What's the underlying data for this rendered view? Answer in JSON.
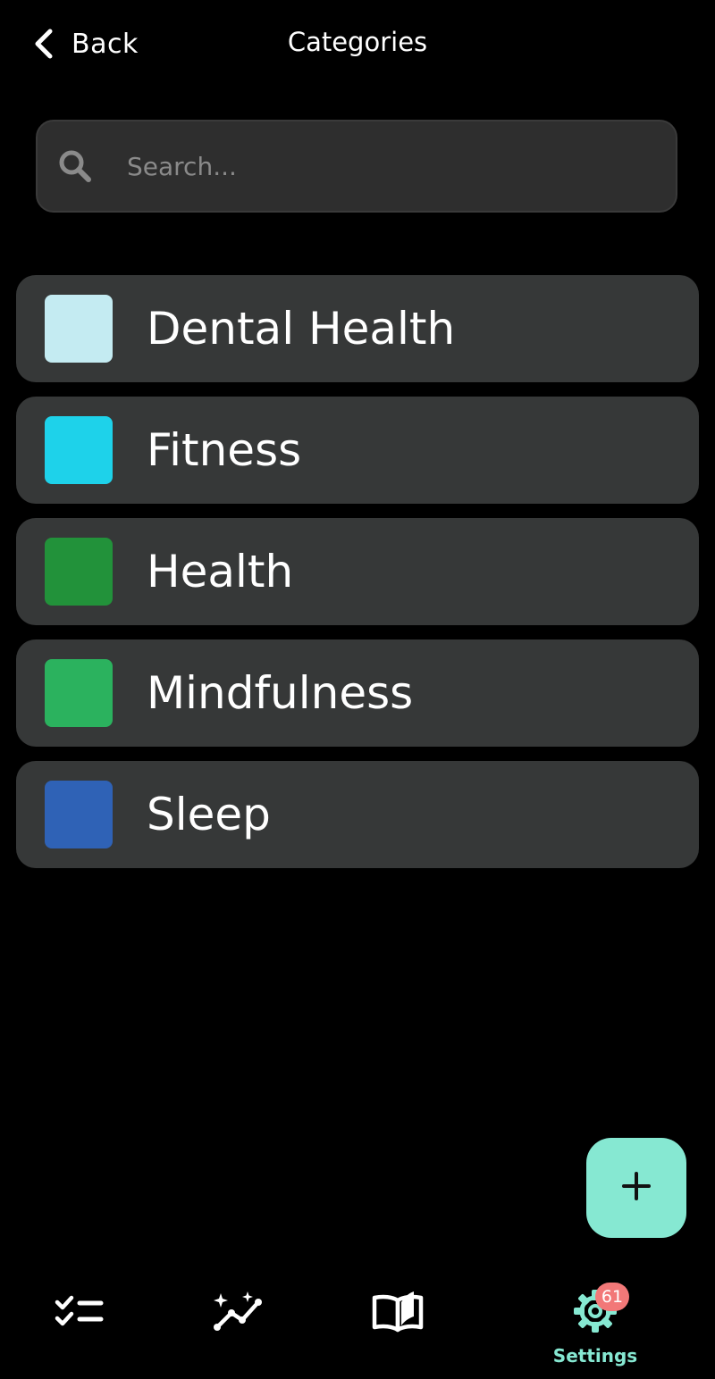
{
  "header": {
    "back_label": "Back",
    "title": "Categories"
  },
  "search": {
    "placeholder": "Search...",
    "value": "",
    "icon": "search-icon"
  },
  "categories": [
    {
      "label": "Dental Health",
      "color": "#c4ebf2"
    },
    {
      "label": "Fitness",
      "color": "#1ed2ea"
    },
    {
      "label": "Health",
      "color": "#22923a"
    },
    {
      "label": "Mindfulness",
      "color": "#2bb25e"
    },
    {
      "label": "Sleep",
      "color": "#2f62b6"
    }
  ],
  "fab": {
    "icon": "plus-icon",
    "color": "#86e8d2"
  },
  "bottom_nav": {
    "items": [
      {
        "icon": "checklist-icon",
        "label": ""
      },
      {
        "icon": "sparkle-chart-icon",
        "label": ""
      },
      {
        "icon": "book-icon",
        "label": ""
      },
      {
        "icon": "gear-icon",
        "label": "Settings",
        "badge": "61",
        "active": true
      }
    ]
  },
  "colors": {
    "background": "#000000",
    "accent": "#86e8d2",
    "card": "#363838",
    "badge": "#f27878"
  }
}
